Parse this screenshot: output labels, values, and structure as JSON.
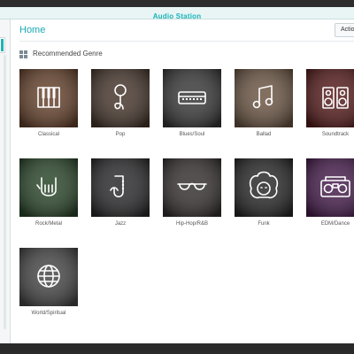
{
  "window": {
    "title": "Audio Station"
  },
  "header": {
    "page_title": "Home",
    "action_label": "Action"
  },
  "section": {
    "title": "Recommended Genre",
    "icon": "grid-icon"
  },
  "genres": [
    {
      "label": "Classical",
      "icon": "piano-icon",
      "bg": "#6a4630"
    },
    {
      "label": "Pop",
      "icon": "microphone-icon",
      "bg": "#4a3a30"
    },
    {
      "label": "Blues/Soul",
      "icon": "harmonica-icon",
      "bg": "#3c3c3c"
    },
    {
      "label": "Ballad",
      "icon": "music-note-icon",
      "bg": "#705a48"
    },
    {
      "label": "Soundtrack",
      "icon": "speakers-icon",
      "bg": "#5a1e1e"
    },
    {
      "label": "Rock/Metal",
      "icon": "rock-hand-icon",
      "bg": "#2e4a2e"
    },
    {
      "label": "Jazz",
      "icon": "saxophone-icon",
      "bg": "#2e2e30"
    },
    {
      "label": "Hip-Hop/R&B",
      "icon": "sunglasses-icon",
      "bg": "#3a3434"
    },
    {
      "label": "Funk",
      "icon": "afro-face-icon",
      "bg": "#2c2c2c"
    },
    {
      "label": "EDM/Dance",
      "icon": "boombox-icon",
      "bg": "#4a2050"
    },
    {
      "label": "World/Spiritual",
      "icon": "globe-icon",
      "bg": "#4a4a4a"
    }
  ]
}
